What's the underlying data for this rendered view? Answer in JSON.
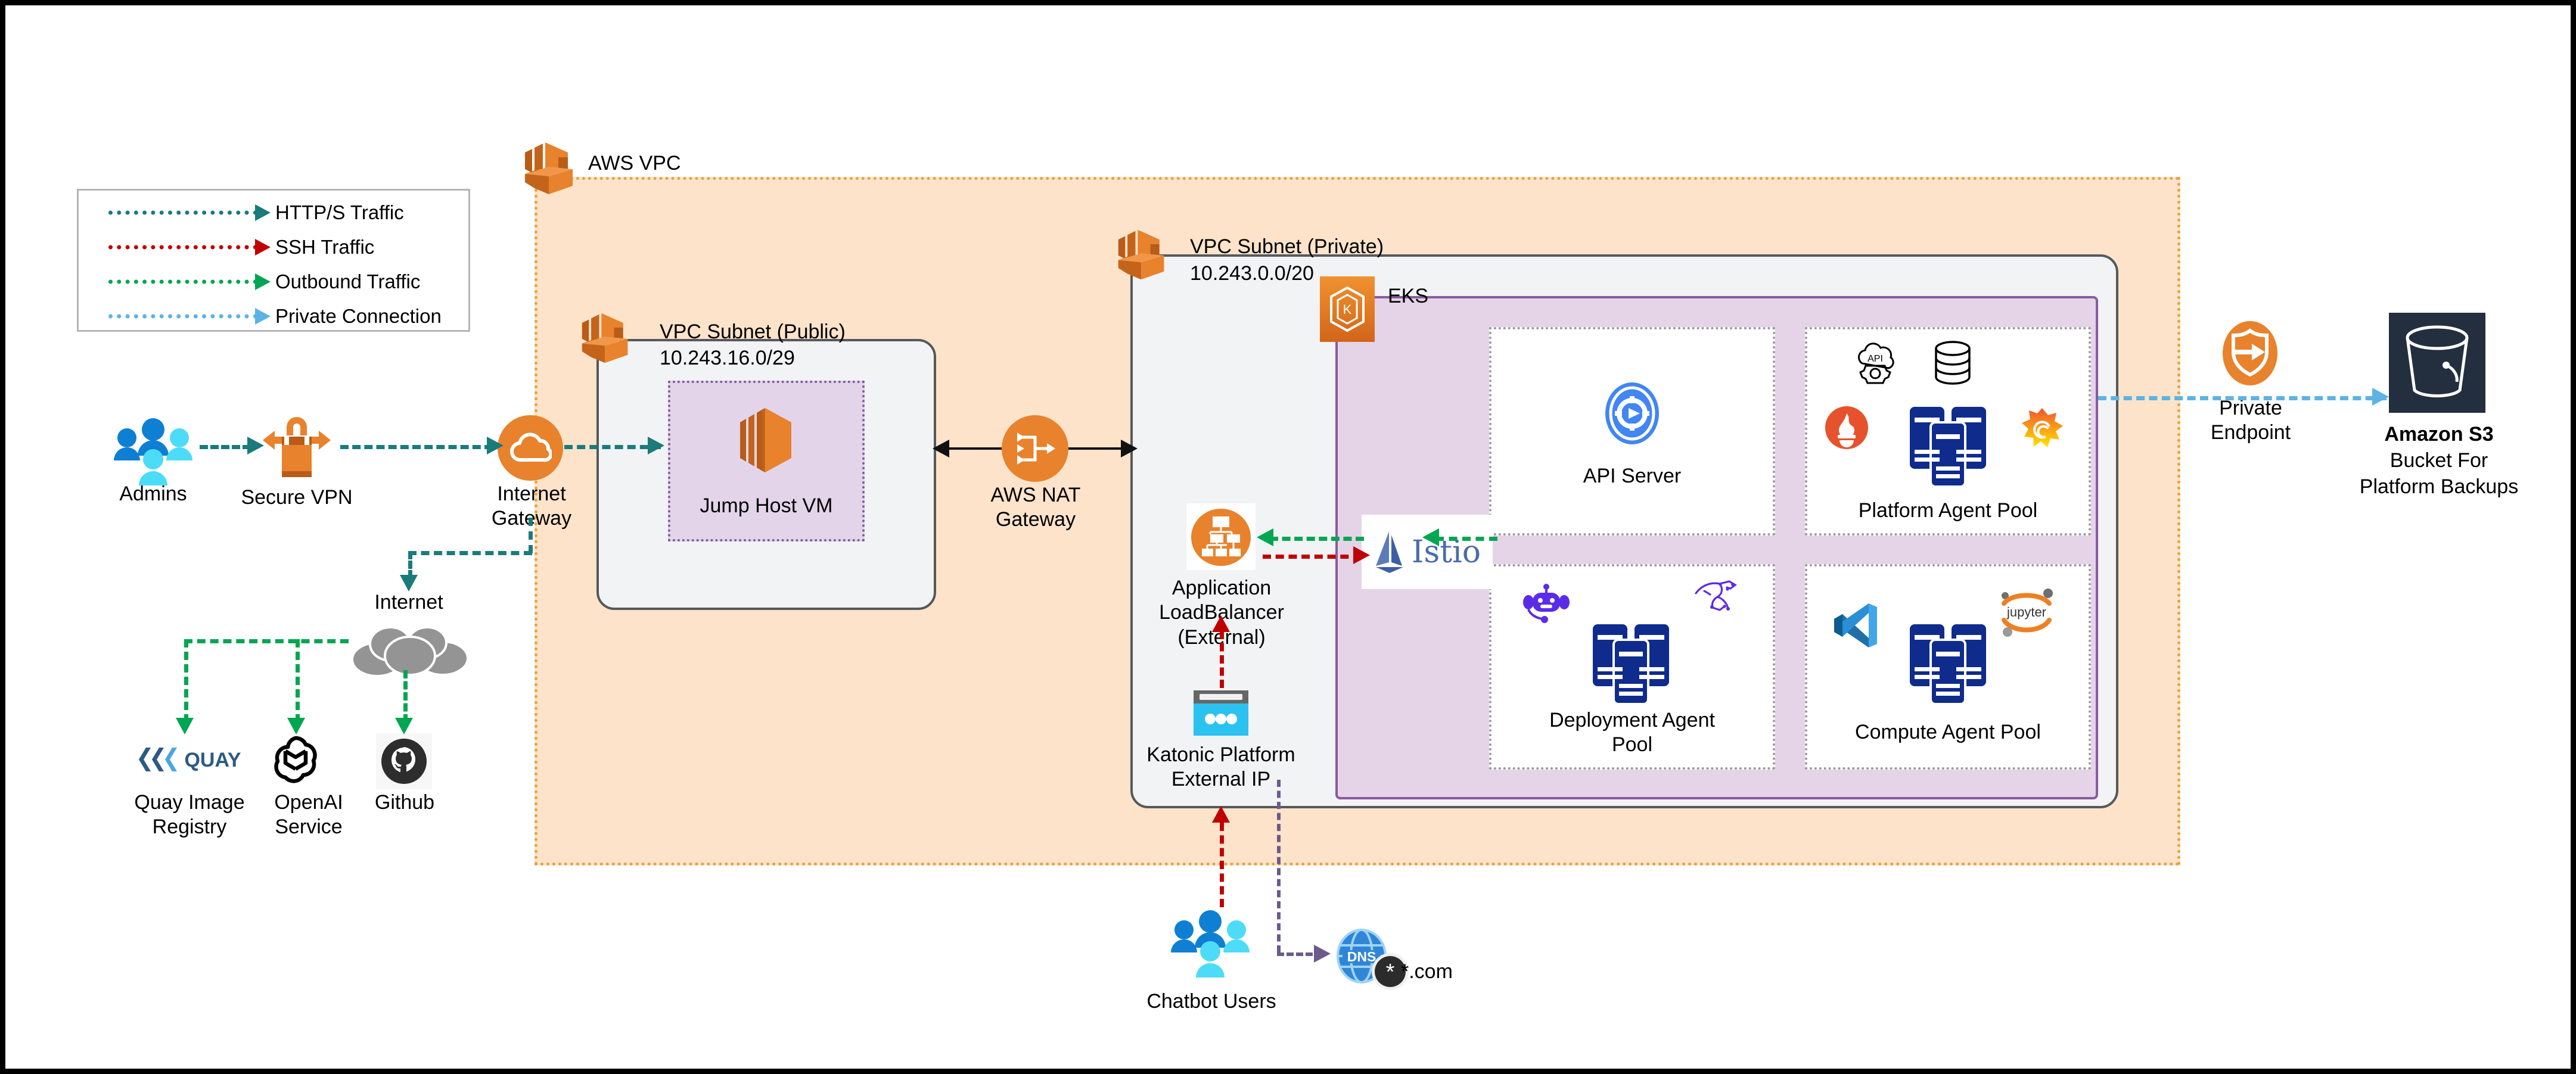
{
  "legend": {
    "items": [
      {
        "label": "HTTP/S Traffic",
        "color": "#1b7b7b",
        "icon": "dotted-arrow-icon"
      },
      {
        "label": "SSH Traffic",
        "color": "#c00000",
        "icon": "dotted-arrow-icon"
      },
      {
        "label": "Outbound Traffic",
        "color": "#00a651",
        "icon": "dotted-arrow-icon"
      },
      {
        "label": "Private Connection",
        "color": "#5cb3e4",
        "icon": "dotted-arrow-icon"
      }
    ]
  },
  "nodes": {
    "admins": "Admins",
    "secure_vpn": "Secure VPN",
    "internet_gateway": "Internet\nGateway",
    "internet": "Internet",
    "quay": "Quay Image\nRegistry",
    "openai": "OpenAI\nService",
    "github": "Github",
    "jump_host": "Jump Host VM",
    "nat_gateway": "AWS NAT\nGateway",
    "app_lb": "Application\nLoadBalancer\n(External)",
    "katonic_ip": "Katonic Platform\nExternal IP",
    "istio": "Istio",
    "api_server": "API Server",
    "platform_pool": "Platform Agent Pool",
    "deployment_pool": "Deployment Agent\nPool",
    "compute_pool": "Compute Agent Pool",
    "private_endpoint": "Private\nEndpoint",
    "s3_line1": "Amazon S3",
    "s3_line2": "Bucket For",
    "s3_line3": "Platform Backups",
    "chatbot_users": "Chatbot Users",
    "dns_badge": "DNS",
    "dns_domain": "*.com"
  },
  "containers": {
    "aws_vpc": "AWS VPC",
    "subnet_public_title": "VPC Subnet (Public)",
    "subnet_public_cidr": "10.243.16.0/29",
    "subnet_private_title": "VPC Subnet (Private)",
    "subnet_private_cidr": "10.243.0.0/20",
    "eks": "EKS"
  },
  "colors": {
    "vpc_fill": "#fde3ca",
    "vpc_border": "#e8a33d",
    "subnet_fill": "#f2f3f4",
    "subnet_border": "#56585b",
    "eks_fill": "#e5d4e8",
    "eks_border": "#8a5aa0",
    "pod_border": "#9a9a9a",
    "aws_orange": "#e8822c",
    "http_teal": "#1b7b7b",
    "ssh_red": "#c00000",
    "outbound_green": "#00a651",
    "private_blue": "#5cb3e4",
    "purple_dns": "#6b5b8a",
    "server_navy": "#0f2b8c"
  }
}
